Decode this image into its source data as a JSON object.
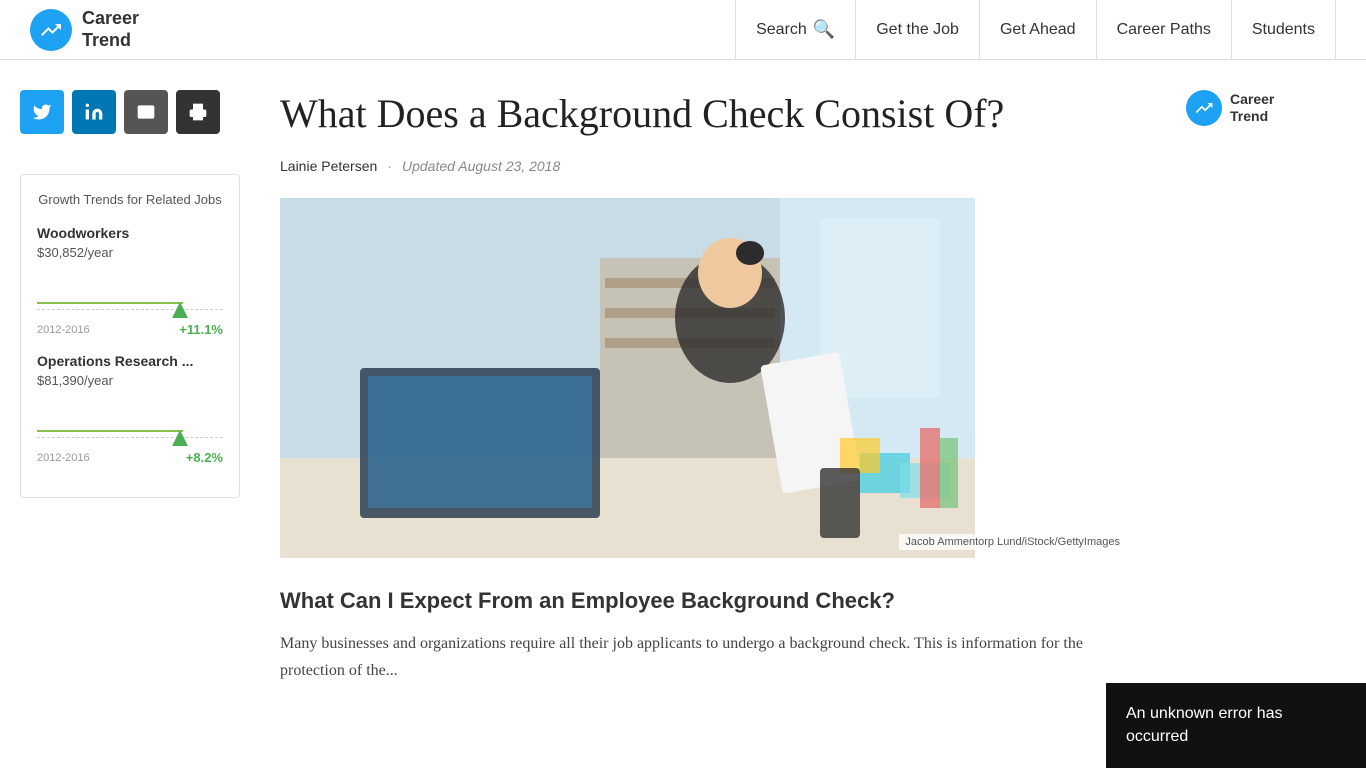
{
  "header": {
    "logo_line1": "Career",
    "logo_line2": "Trend",
    "nav_items": [
      {
        "label": "Search",
        "has_icon": true
      },
      {
        "label": "Get the Job",
        "has_icon": false
      },
      {
        "label": "Get Ahead",
        "has_icon": false
      },
      {
        "label": "Career Paths",
        "has_icon": false
      },
      {
        "label": "Students",
        "has_icon": false
      }
    ]
  },
  "article": {
    "title": "What Does a Background Check Consist Of?",
    "author": "Lainie Petersen",
    "updated_label": "Updated August 23, 2018",
    "image_caption": "Jacob Ammentorp Lund/iStock/GettyImages",
    "section_heading": "What Can I Expect From an Employee Background Check?",
    "body_text": "Many businesses and organizations require all their job applicants to undergo a background check. This is information for the protection of the..."
  },
  "sidebar": {
    "growth_widget_title": "Growth Trends for Related Jobs",
    "jobs": [
      {
        "name": "Woodworkers",
        "salary": "$30,852/year",
        "year_range": "2012-2016",
        "pct_change": "+11.1%"
      },
      {
        "name": "Operations Research ...",
        "salary": "$81,390/year",
        "year_range": "2012-2016",
        "pct_change": "+8.2%"
      }
    ]
  },
  "social": {
    "twitter_label": "Twitter",
    "linkedin_label": "LinkedIn",
    "email_label": "Email",
    "print_label": "Print"
  },
  "brand_right": {
    "line1": "Career",
    "line2": "Trend"
  },
  "error_toast": {
    "message": "An unknown error has occurred"
  }
}
